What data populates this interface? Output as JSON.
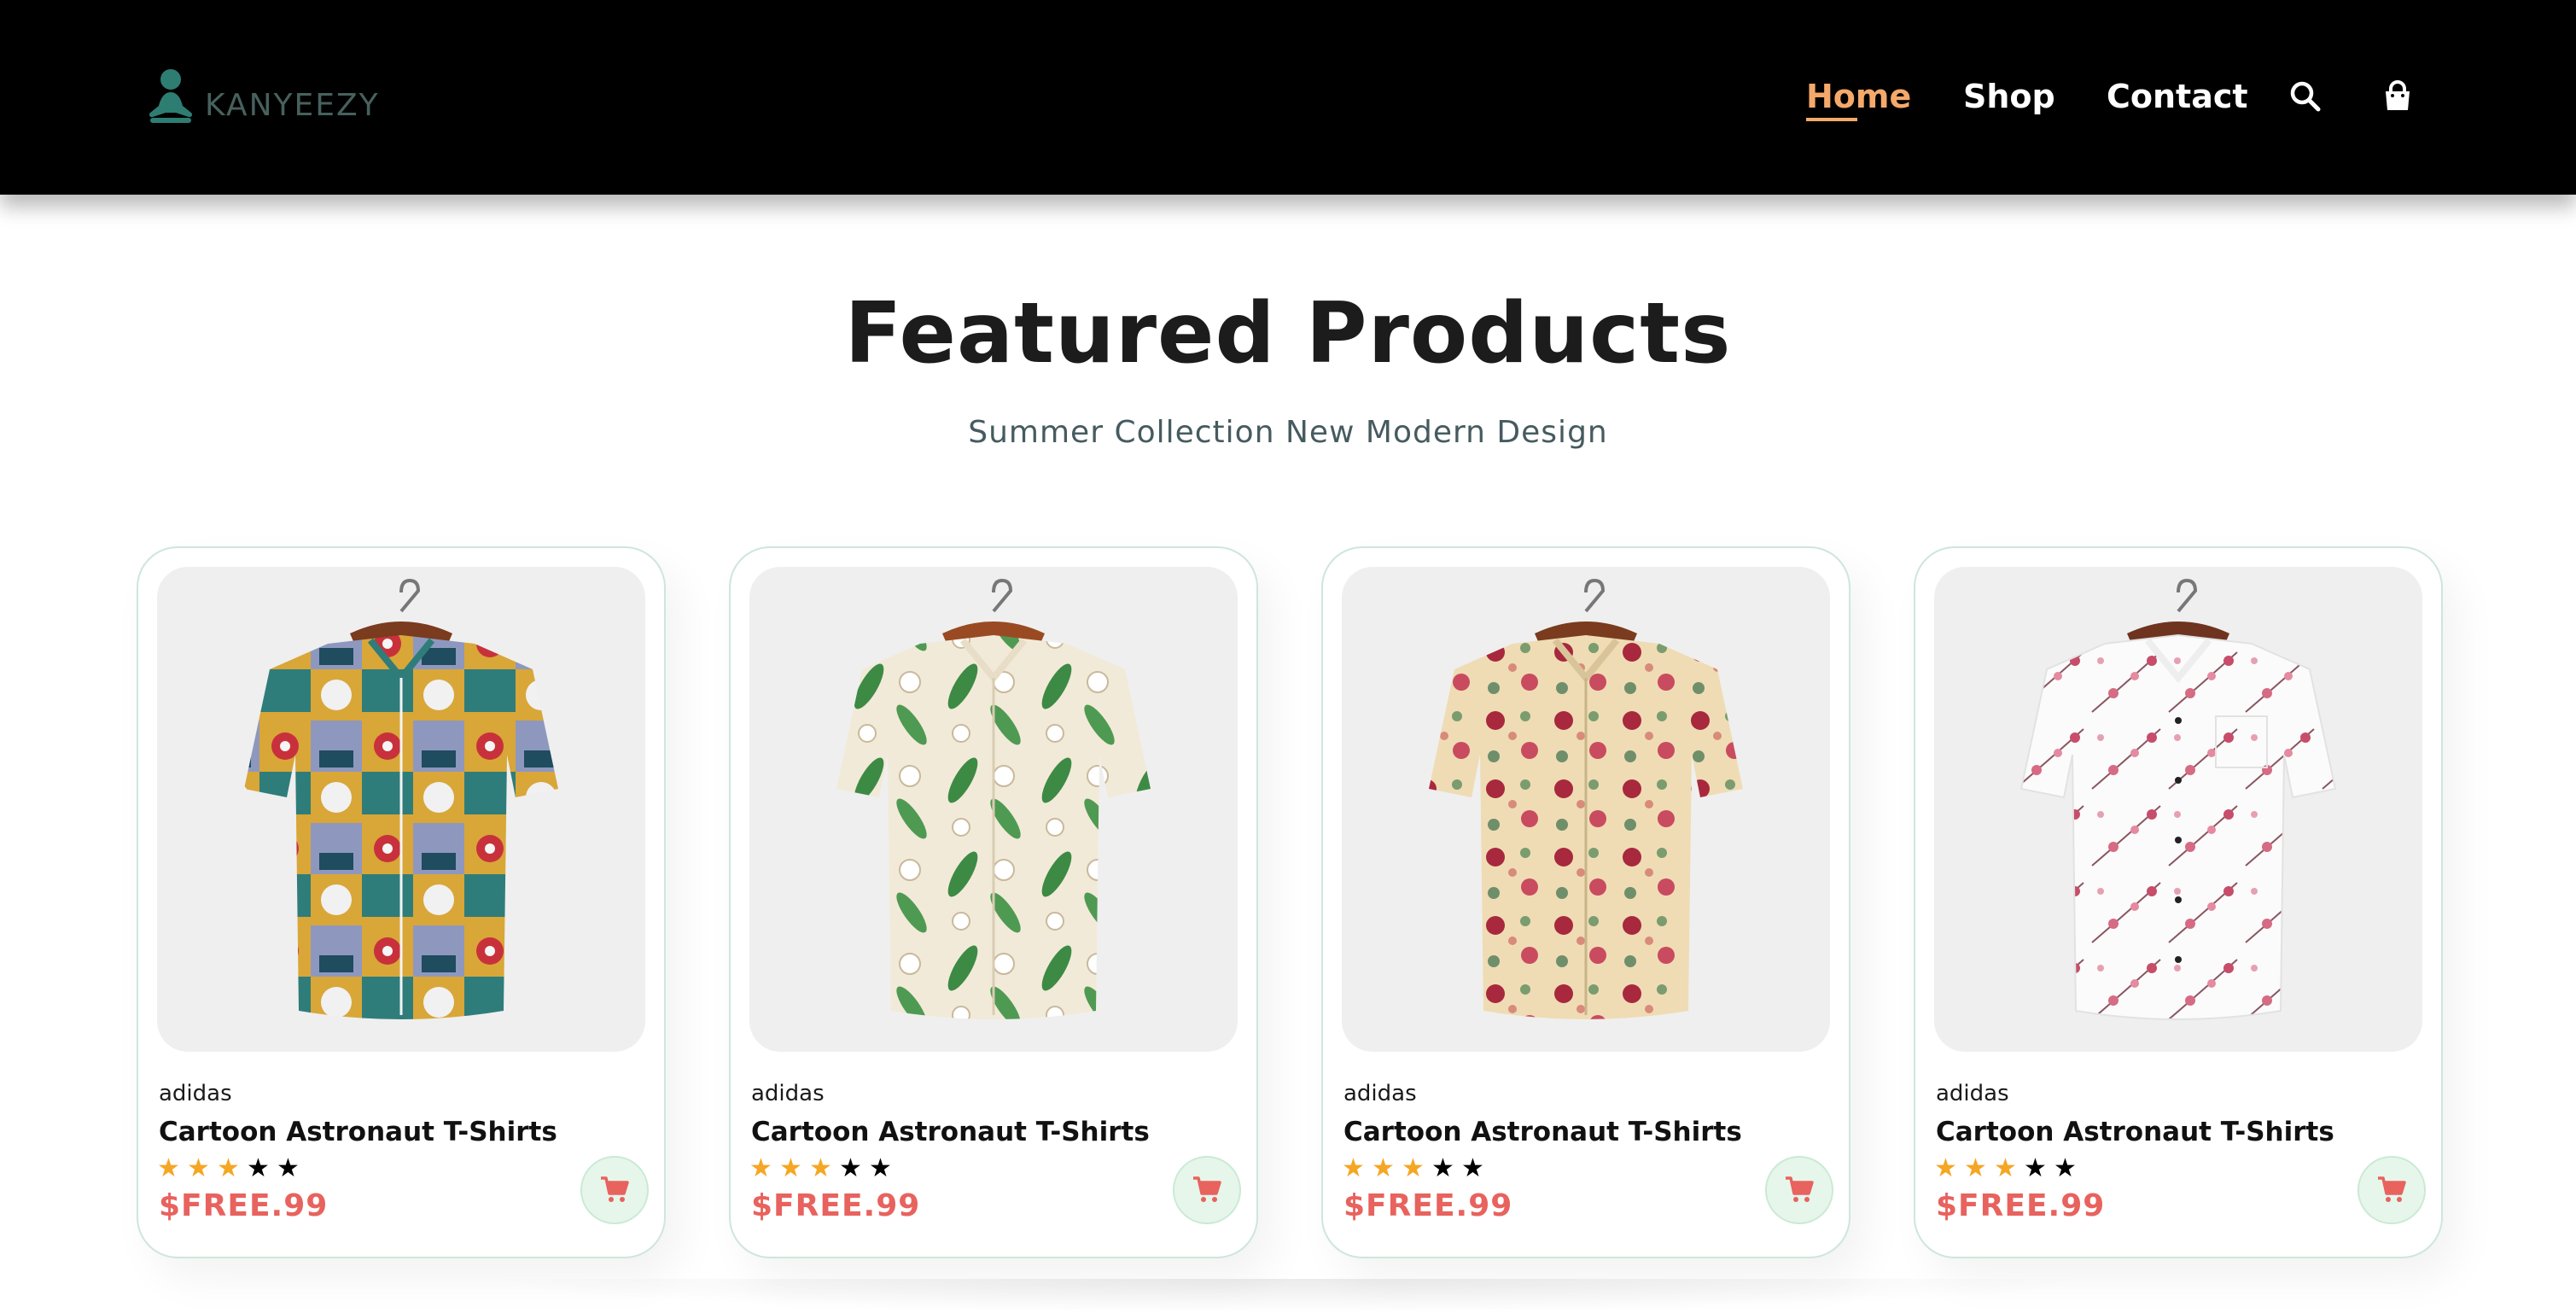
{
  "header": {
    "logo_text": "KANYEEZY",
    "logo_icon": "person-meditation-icon",
    "nav": [
      {
        "label": "Home",
        "active": true
      },
      {
        "label": "Shop",
        "active": false
      },
      {
        "label": "Contact",
        "active": false
      }
    ],
    "icons": [
      "search-icon",
      "shopping-bag-icon"
    ]
  },
  "section": {
    "title": "Featured Products",
    "subtitle": "Summer Collection New Modern Design"
  },
  "products": [
    {
      "brand": "adidas",
      "name": "Cartoon Astronaut T-Shirts",
      "rating": 3,
      "max_rating": 5,
      "price": "$FREE.99",
      "image": "abstract-print-shirt"
    },
    {
      "brand": "adidas",
      "name": "Cartoon Astronaut T-Shirts",
      "rating": 3,
      "max_rating": 5,
      "price": "$FREE.99",
      "image": "lily-leaf-print-shirt"
    },
    {
      "brand": "adidas",
      "name": "Cartoon Astronaut T-Shirts",
      "rating": 3,
      "max_rating": 5,
      "price": "$FREE.99",
      "image": "rose-floral-print-shirt"
    },
    {
      "brand": "adidas",
      "name": "Cartoon Astronaut T-Shirts",
      "rating": 3,
      "max_rating": 5,
      "price": "$FREE.99",
      "image": "cherry-blossom-print-shirt"
    }
  ],
  "colors": {
    "header_bg": "#000000",
    "nav_active": "#f4a96b",
    "logo": "#47615d",
    "star": "#f5a623",
    "price": "#e8625e",
    "cart_bg": "#e6f6eb",
    "cart_icon": "#e8625e",
    "card_border": "#cfe6da"
  }
}
